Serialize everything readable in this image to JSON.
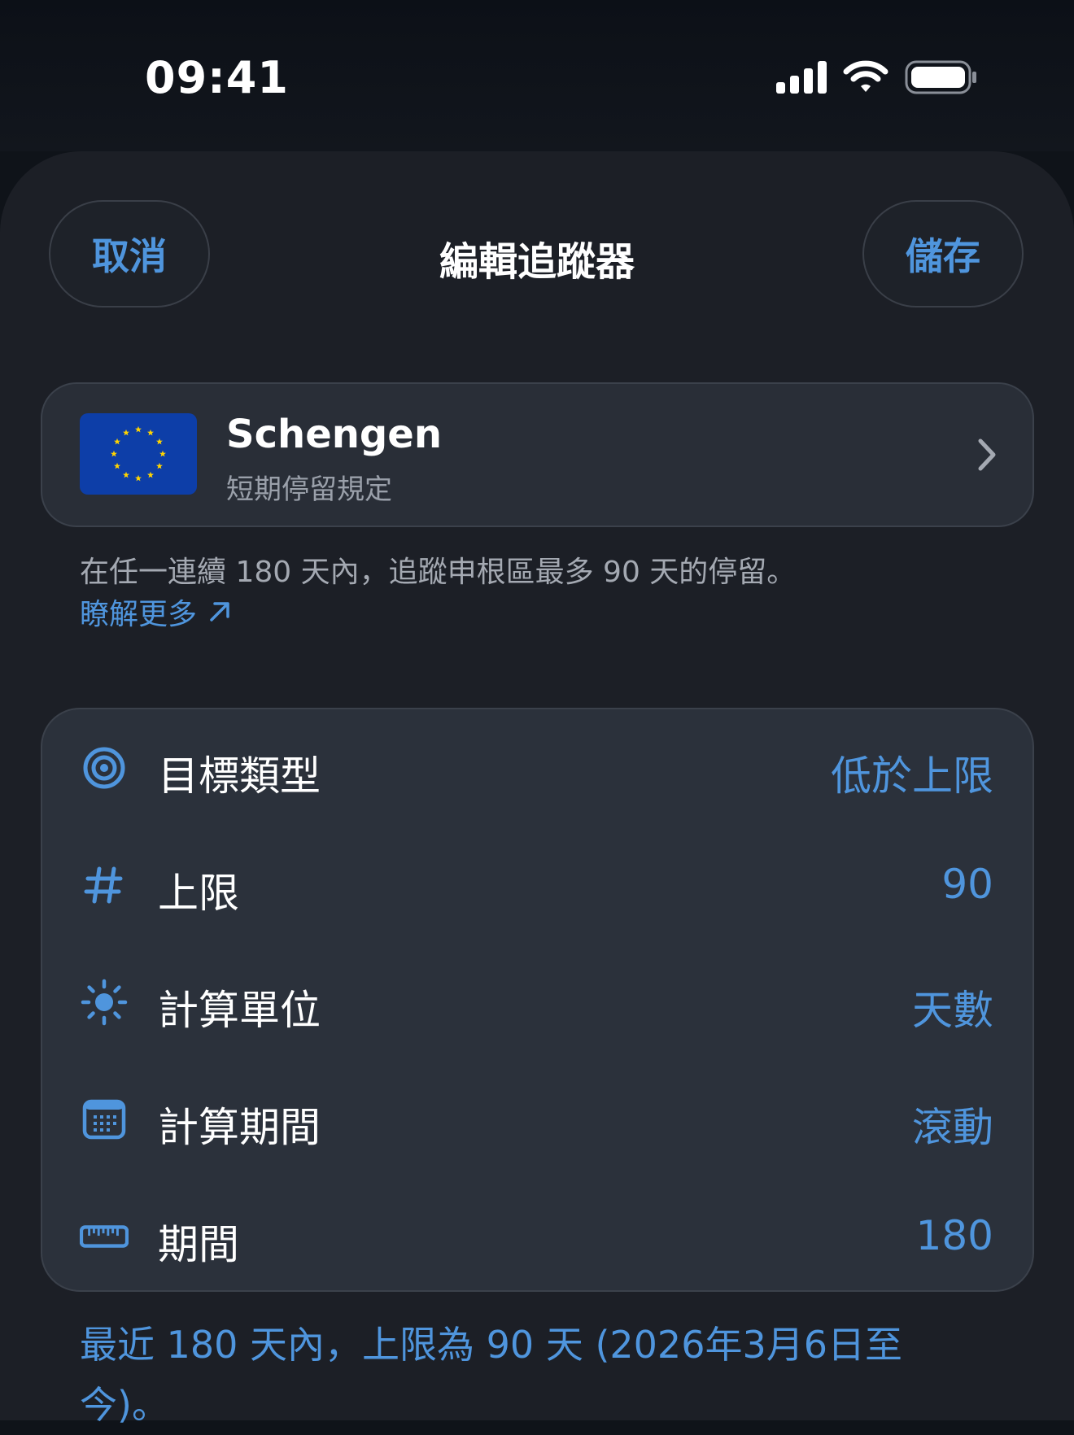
{
  "status_bar": {
    "time": "09:41"
  },
  "nav": {
    "cancel_label": "取消",
    "title": "編輯追蹤器",
    "save_label": "儲存"
  },
  "region": {
    "name": "Schengen",
    "subtitle": "短期停留規定",
    "flag_icon": "eu-flag-icon"
  },
  "description": "在任一連續 180 天內，追蹤申根區最多 90 天的停留。",
  "learn_more_label": "瞭解更多",
  "settings": {
    "rows": [
      {
        "icon": "target-icon",
        "label": "目標類型",
        "value": "低於上限"
      },
      {
        "icon": "hash-icon",
        "label": "上限",
        "value": "90"
      },
      {
        "icon": "sun-icon",
        "label": "計算單位",
        "value": "天數"
      },
      {
        "icon": "calendar-icon",
        "label": "計算期間",
        "value": "滾動"
      },
      {
        "icon": "ruler-icon",
        "label": "期間",
        "value": "180"
      }
    ]
  },
  "footer_note": "最近 180 天內，上限為 90 天 (2026年3月6日至今)。",
  "colors": {
    "accent": "#4f95dd",
    "background": "#1c1f26",
    "card": "#2b313b",
    "flag_blue": "#0d3ea8",
    "flag_star": "#ffd400"
  }
}
